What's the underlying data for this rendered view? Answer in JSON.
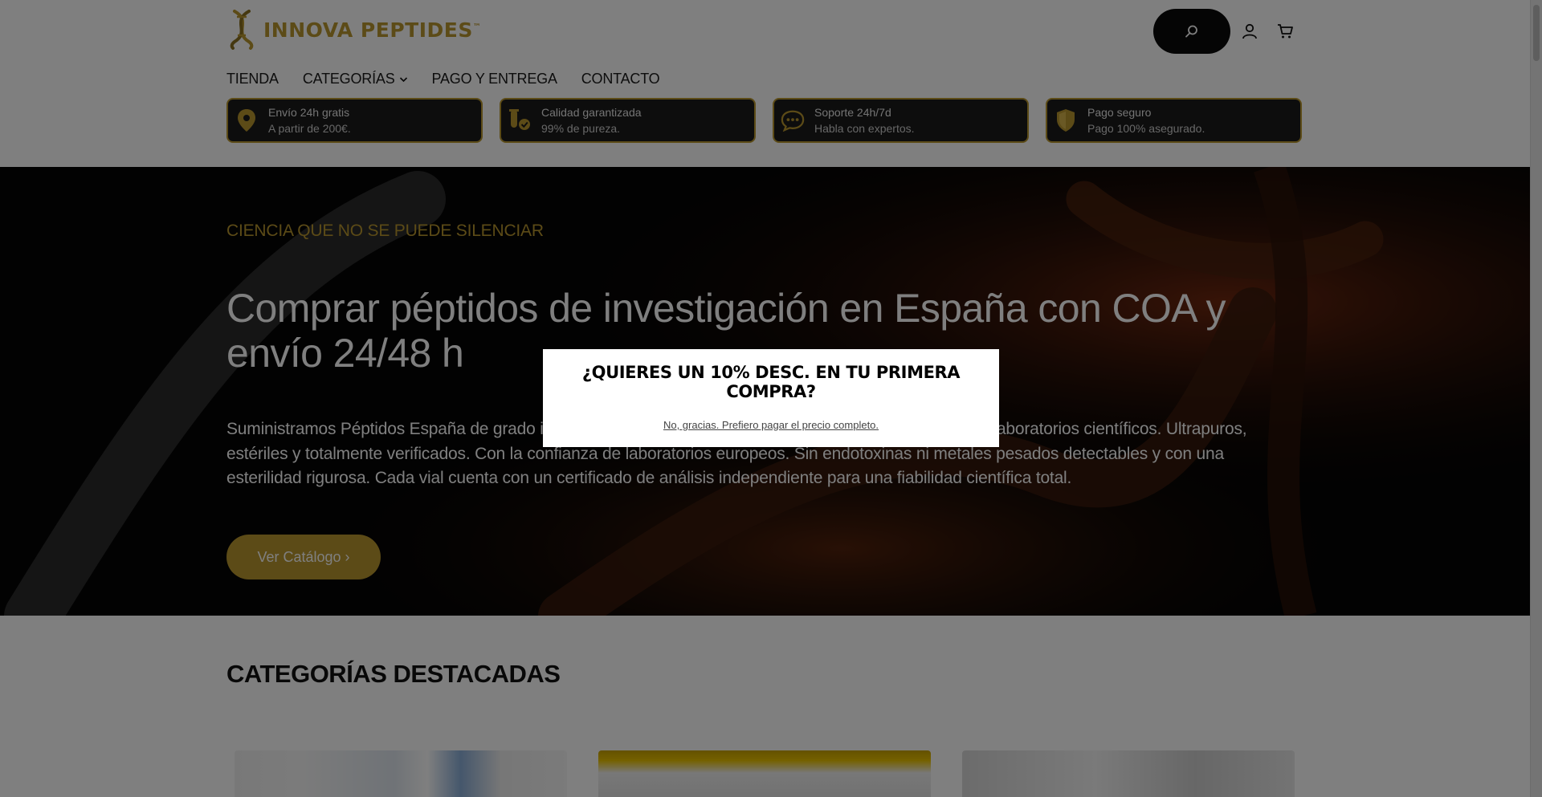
{
  "brand": {
    "name": "INNOVA PEPTIDES",
    "tm": "™",
    "accent_color": "#b8962e"
  },
  "header": {
    "search_icon": "search-icon",
    "account_icon": "user-icon",
    "cart_icon": "cart-icon"
  },
  "nav": {
    "items": [
      {
        "label": "TIENDA"
      },
      {
        "label": "CATEGORÍAS",
        "dropdown": true
      },
      {
        "label": "PAGO Y ENTREGA"
      },
      {
        "label": "CONTACTO"
      }
    ]
  },
  "features": [
    {
      "icon": "location-pin-icon",
      "title": "Envío 24h gratis",
      "subtitle": "A partir de 200€."
    },
    {
      "icon": "quality-check-icon",
      "title": "Calidad garantizada",
      "subtitle": "99% de pureza."
    },
    {
      "icon": "chat-bubble-icon",
      "title": "Soporte 24h/7d",
      "subtitle": "Habla con expertos."
    },
    {
      "icon": "shield-icon",
      "title": "Pago seguro",
      "subtitle": "Pago 100% asegurado."
    }
  ],
  "hero": {
    "kicker": "CIENCIA QUE NO SE PUEDE SILENCIAR",
    "title": "Comprar péptidos de investigación en España con COA y envío 24/48 h",
    "text": "Suministramos Péptidos España de grado investigación, con la máxima pureza y un suministro fiable en laboratorios científicos. Ultrapuros, estériles y totalmente verificados. Con la confianza de laboratorios europeos. Sin endotoxinas ni metales pesados detectables y con una esterilidad rigurosa. Cada vial cuenta con un certificado de análisis independiente para una fiabilidad científica total.",
    "cta_label": "Ver Catálogo ›"
  },
  "categories": {
    "title": "CATEGORÍAS DESTACADAS"
  },
  "modal": {
    "title": "¿QUIERES UN 10% DESC. EN TU PRIMERA COMPRA?",
    "decline": "No, gracias. Prefiero pagar el precio completo."
  }
}
